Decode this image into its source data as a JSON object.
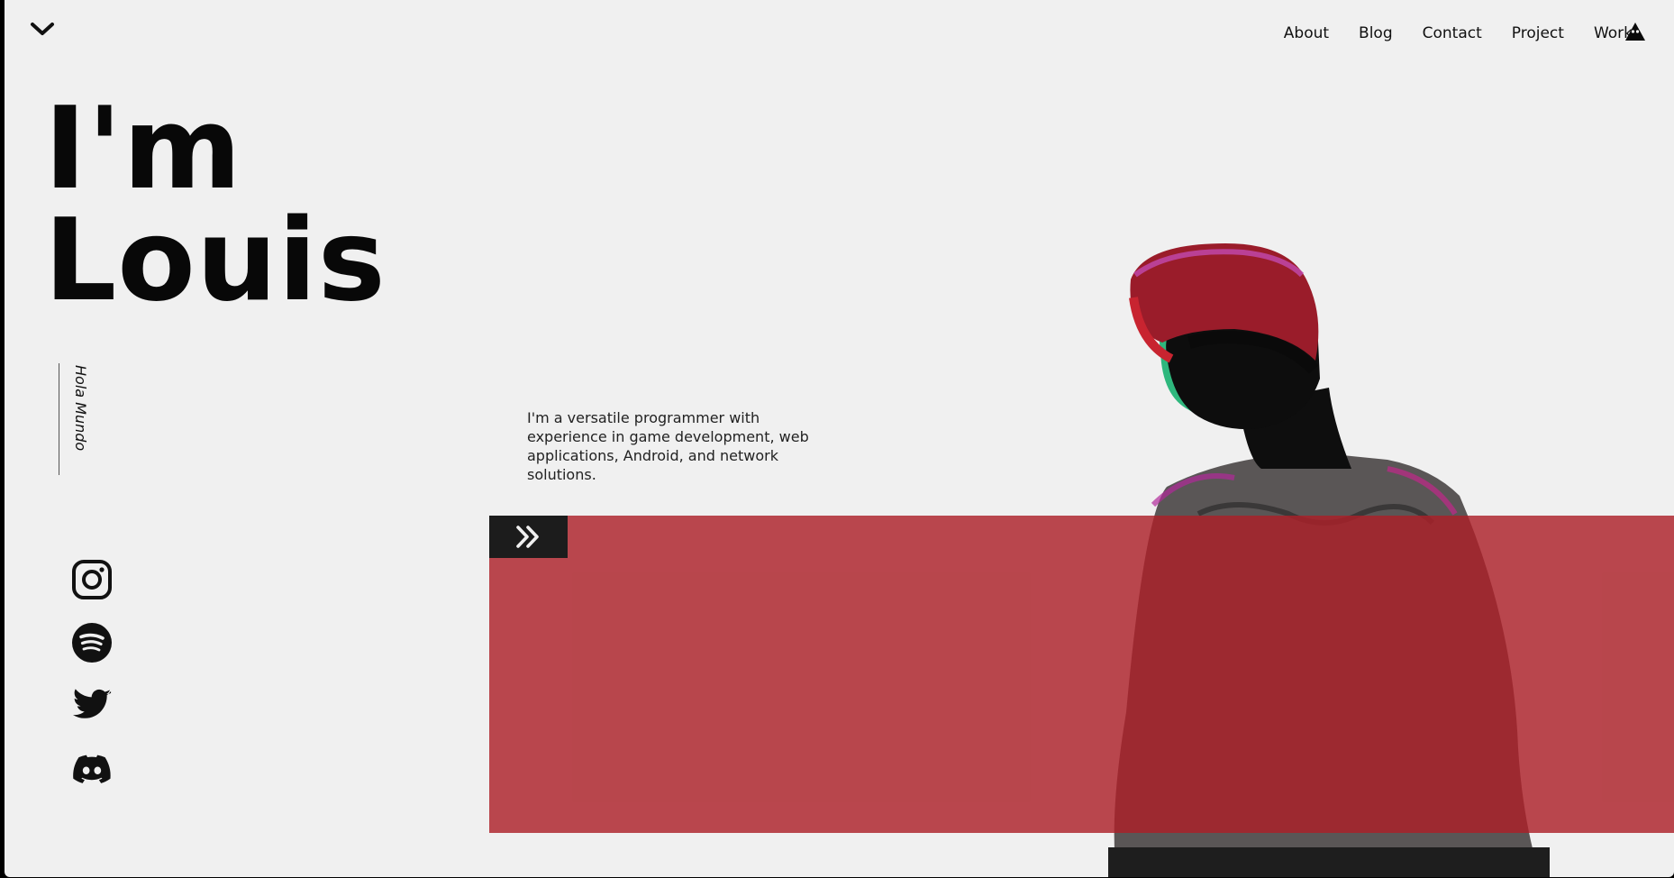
{
  "nav": {
    "items": [
      "About",
      "Blog",
      "Contact",
      "Project",
      "Work"
    ]
  },
  "hero": {
    "line1": "I'm",
    "line2": "Louis",
    "tagline": "Hola Mundo",
    "intro": "I'm a versatile programmer with experience in game development, web applications, Android, and network solutions."
  },
  "social": {
    "icons": [
      "instagram-icon",
      "spotify-icon",
      "twitter-icon",
      "discord-icon"
    ]
  },
  "colors": {
    "background": "#f0f0f0",
    "accent_red": "#ac2028",
    "dark": "#1c1c1c",
    "text": "#080808"
  }
}
